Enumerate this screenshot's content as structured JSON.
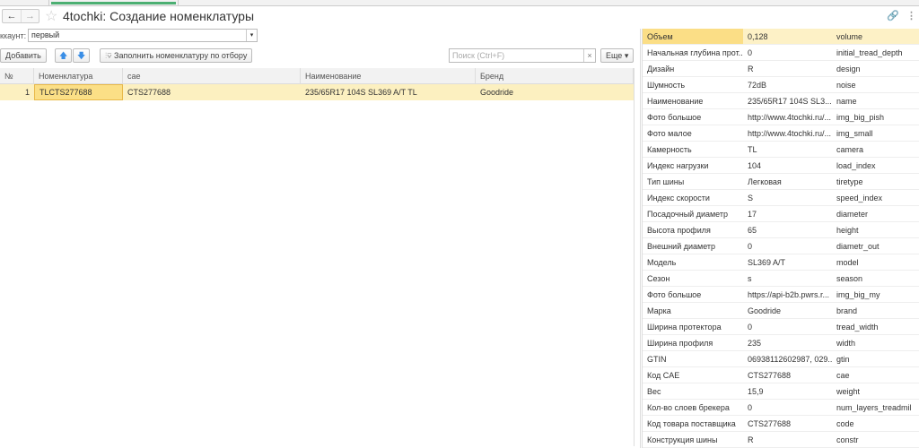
{
  "window": {
    "title": "4tochki: Создание номенклатуры",
    "back": "←",
    "forward": "→",
    "star": "☆",
    "link_icon": "link-icon",
    "more_icon": "more-icon"
  },
  "filter": {
    "label": "ккаунт:",
    "value": "первый"
  },
  "toolbar": {
    "add": "Добавить",
    "up": "🡅",
    "down": "🡇",
    "fill": "Заполнить номенклатуру по отбору",
    "search_placeholder": "Поиск (Ctrl+F)",
    "clear": "×",
    "more": "Еще ▾"
  },
  "table": {
    "columns": [
      "№",
      "Номенклатура",
      "сае",
      "Наименование",
      "Бренд"
    ],
    "rows": [
      [
        "1",
        "TLCTS277688",
        "CTS277688",
        "235/65R17 104S SL369 A/T TL",
        "Goodride"
      ]
    ]
  },
  "properties": [
    [
      "Объем",
      "0,128",
      "volume"
    ],
    [
      "Начальная глубина прот...",
      "0",
      "initial_tread_depth"
    ],
    [
      "Дизайн",
      "R",
      "design"
    ],
    [
      "Шумность",
      "72dB",
      "noise"
    ],
    [
      "Наименование",
      "235/65R17 104S SL3...",
      "name"
    ],
    [
      "Фото большое",
      "http://www.4tochki.ru/...",
      "img_big_pish"
    ],
    [
      "Фото малое",
      "http://www.4tochki.ru/...",
      "img_small"
    ],
    [
      "Камерность",
      "TL",
      "camera"
    ],
    [
      "Индекс нагрузки",
      "104",
      "load_index"
    ],
    [
      "Тип шины",
      "Легковая",
      "tiretype"
    ],
    [
      "Индекс скорости",
      "S",
      "speed_index"
    ],
    [
      "Посадочный диаметр",
      "17",
      "diameter"
    ],
    [
      "Высота профиля",
      "65",
      "height"
    ],
    [
      "Внешний диаметр",
      "0",
      "diametr_out"
    ],
    [
      "Модель",
      "SL369 A/T",
      "model"
    ],
    [
      "Сезон",
      "s",
      "season"
    ],
    [
      "Фото большое",
      "https://api-b2b.pwrs.r...",
      "img_big_my"
    ],
    [
      "Марка",
      "Goodride",
      "brand"
    ],
    [
      "Ширина протектора",
      "0",
      "tread_width"
    ],
    [
      "Ширина профиля",
      "235",
      "width"
    ],
    [
      "GTIN",
      "06938112602987, 029...",
      "gtin"
    ],
    [
      "Код CAE",
      "CTS277688",
      "cae"
    ],
    [
      "Вес",
      "15,9",
      "weight"
    ],
    [
      "Кол-во слоев брекера",
      "0",
      "num_layers_treadmil"
    ],
    [
      "Код товара поставщика",
      "CTS277688",
      "code"
    ],
    [
      "Конструкция шины",
      "R",
      "constr"
    ]
  ],
  "colors": {
    "selected_row": "#fcf0c0",
    "current_cell": "#fbdf86",
    "tab_accent": "#4caf72"
  }
}
